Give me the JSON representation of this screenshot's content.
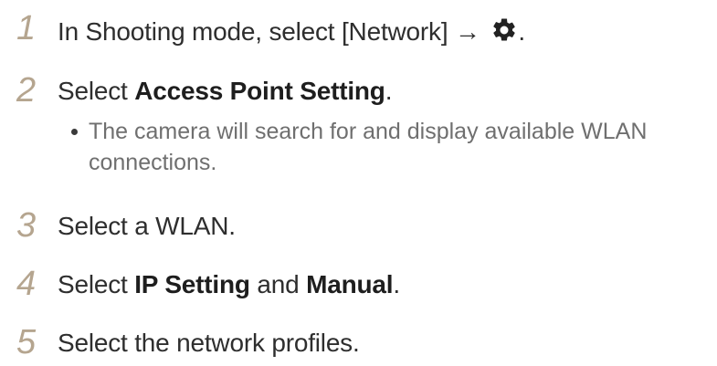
{
  "steps": [
    {
      "number": "1",
      "text_before": "In Shooting mode, select [Network] → ",
      "icon": "gear-icon",
      "text_after": "."
    },
    {
      "number": "2",
      "prefix": "Select ",
      "bold": "Access Point Setting",
      "suffix": ".",
      "bullet": "The camera will search for and display available WLAN connections."
    },
    {
      "number": "3",
      "text": "Select a WLAN."
    },
    {
      "number": "4",
      "prefix": "Select ",
      "bold1": "IP Setting",
      "middle": " and ",
      "bold2": "Manual",
      "suffix": "."
    },
    {
      "number": "5",
      "text": "Select the network profiles."
    }
  ],
  "colors": {
    "step_number": "#b5a58f",
    "body_text": "#2e2e2e",
    "bullet_text": "#6f6f6f"
  }
}
